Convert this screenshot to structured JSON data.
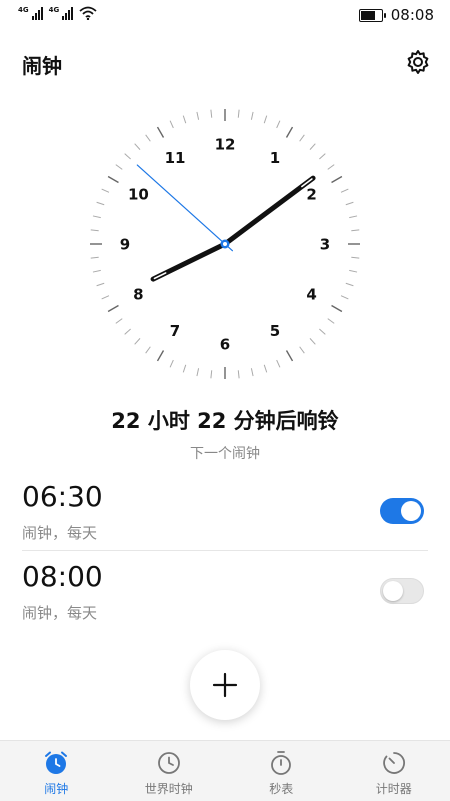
{
  "status_bar": {
    "network_1": "4G",
    "network_2": "4G",
    "battery_level": 0.85,
    "time": "08:08"
  },
  "header": {
    "title": "闹钟",
    "settings_icon": "gear-icon"
  },
  "clock": {
    "numbers": [
      "12",
      "1",
      "2",
      "3",
      "4",
      "5",
      "6",
      "7",
      "8",
      "9",
      "10",
      "11"
    ],
    "hour": 8,
    "minute": 8,
    "second": 52,
    "second_hand_color": "#1e78e6",
    "hand_color": "#111111"
  },
  "next_alarm": {
    "countdown": "22 小时  22 分钟后响铃",
    "label": "下一个闹钟"
  },
  "alarms": [
    {
      "time": "06:30",
      "desc": "闹钟，每天",
      "enabled": true
    },
    {
      "time": "08:00",
      "desc": "闹钟，每天",
      "enabled": false
    }
  ],
  "add_button": {
    "icon": "plus-icon"
  },
  "bottom_nav": {
    "active_color": "#1e78e6",
    "tabs": [
      {
        "label": "闹钟",
        "icon": "alarm-clock-icon",
        "active": true
      },
      {
        "label": "世界时钟",
        "icon": "clock-icon",
        "active": false
      },
      {
        "label": "秒表",
        "icon": "stopwatch-icon",
        "active": false
      },
      {
        "label": "计时器",
        "icon": "timer-icon",
        "active": false
      }
    ]
  }
}
